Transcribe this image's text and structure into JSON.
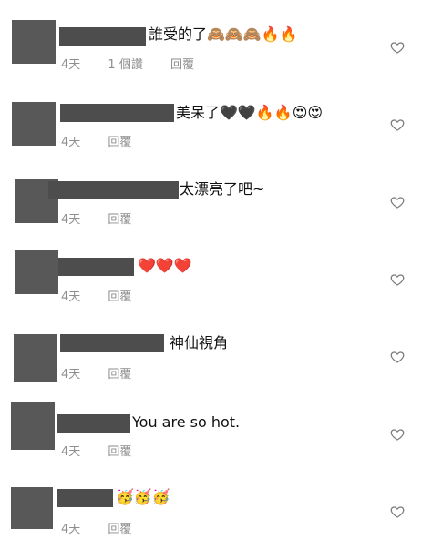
{
  "comments": [
    {
      "text": "誰受的了🙈🙈🙈🔥🔥",
      "time": "4天",
      "likes": "1 個讚",
      "reply": "回覆"
    },
    {
      "text": "美呆了🖤🖤🔥🔥😍😍",
      "time": "4天",
      "reply": "回覆"
    },
    {
      "text": "太漂亮了吧~",
      "time": "4天",
      "reply": "回覆"
    },
    {
      "text": "❤️❤️❤️",
      "time": "4天",
      "reply": "回覆"
    },
    {
      "text": "神仙視角",
      "time": "4天",
      "reply": "回覆"
    },
    {
      "text": "You are so hot.",
      "time": "4天",
      "reply": "回覆"
    },
    {
      "text": "🥳🥳🥳",
      "time": "4天",
      "reply": "回覆"
    }
  ]
}
